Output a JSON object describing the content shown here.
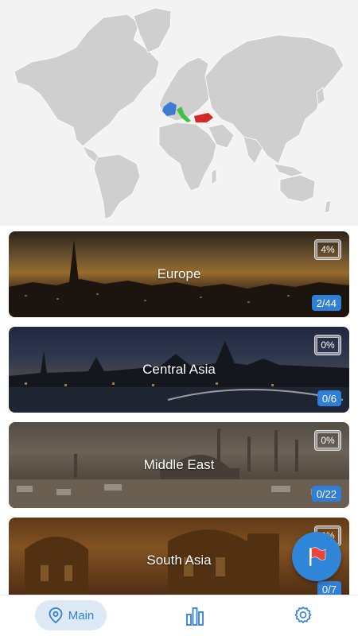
{
  "map": {
    "highlighted_countries": [
      "France",
      "Italy",
      "Turkey"
    ],
    "colors": {
      "land": "#cfcfcf",
      "ocean": "#f3f3f3",
      "france": "#3a7bd5",
      "italy": "#3cc23c",
      "turkey": "#d42828"
    }
  },
  "regions": [
    {
      "name": "Europe",
      "percent": "4%",
      "progress": "2/44"
    },
    {
      "name": "Central Asia",
      "percent": "0%",
      "progress": "0/6"
    },
    {
      "name": "Middle East",
      "percent": "0%",
      "progress": "0/22"
    },
    {
      "name": "South Asia",
      "percent": "0%",
      "progress": "0/7"
    }
  ],
  "fab": {
    "icon": "flag-icon",
    "color": "#2f86d8"
  },
  "bottom_nav": {
    "main_label": "Main",
    "main_icon": "map-pin-icon",
    "stats_icon": "bar-chart-icon",
    "settings_icon": "gear-icon",
    "accent": "#2f7fd6"
  }
}
